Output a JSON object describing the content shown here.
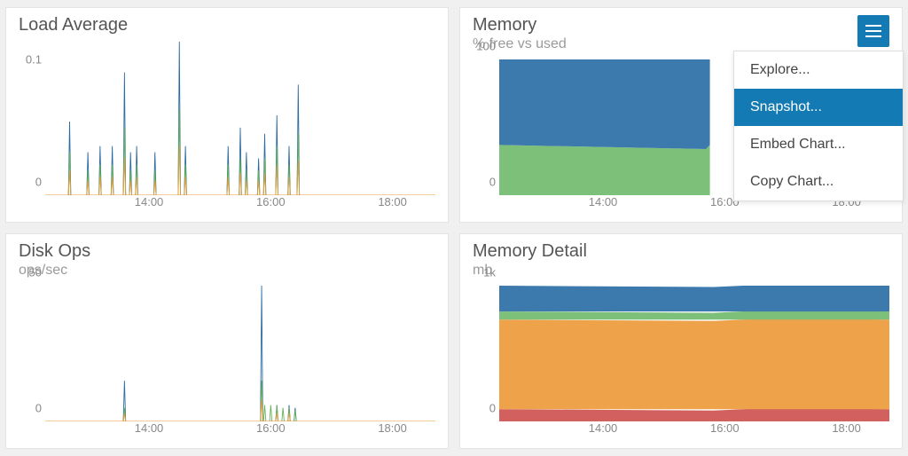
{
  "cards": {
    "loadAvg": {
      "title": "Load Average",
      "subtitle": ""
    },
    "memory": {
      "title": "Memory",
      "subtitle": "% free vs used"
    },
    "diskOps": {
      "title": "Disk Ops",
      "subtitle": "ops/sec"
    },
    "memDetail": {
      "title": "Memory Detail",
      "subtitle": "mb"
    }
  },
  "menu": {
    "items": [
      "Explore...",
      "Snapshot...",
      "Embed Chart...",
      "Copy Chart..."
    ],
    "selectedIndex": 1
  },
  "chart_data": [
    {
      "id": "loadAvg",
      "type": "line",
      "title": "Load Average",
      "xlabel": "",
      "ylabel": "",
      "xlim": [
        12.3,
        18.7
      ],
      "ylim": [
        0,
        0.125
      ],
      "x_ticks": [
        14,
        16,
        18
      ],
      "x_tick_labels": [
        "14:00",
        "16:00",
        "18:00"
      ],
      "y_ticks": [
        0,
        0.1
      ],
      "series": [
        {
          "name": "blue",
          "color": "#2d6ca2",
          "x": [
            12.7,
            13.0,
            13.2,
            13.4,
            13.6,
            13.7,
            13.8,
            14.1,
            14.5,
            14.6,
            15.3,
            15.5,
            15.6,
            15.8,
            15.9,
            16.1,
            16.3,
            16.45
          ],
          "y": [
            0.06,
            0.035,
            0.04,
            0.04,
            0.1,
            0.035,
            0.04,
            0.035,
            0.125,
            0.04,
            0.04,
            0.055,
            0.035,
            0.03,
            0.05,
            0.065,
            0.04,
            0.09
          ]
        },
        {
          "name": "green",
          "color": "#65b257",
          "x": [
            12.7,
            13.0,
            13.2,
            13.4,
            13.6,
            13.7,
            13.8,
            14.1,
            14.5,
            14.6,
            15.3,
            15.5,
            15.6,
            15.8,
            15.9,
            16.1,
            16.3,
            16.45
          ],
          "y": [
            0.035,
            0.02,
            0.025,
            0.025,
            0.055,
            0.02,
            0.025,
            0.02,
            0.07,
            0.025,
            0.025,
            0.03,
            0.02,
            0.02,
            0.03,
            0.04,
            0.025,
            0.05
          ]
        },
        {
          "name": "orange",
          "color": "#e79b3a",
          "x": [
            12.7,
            13.0,
            13.2,
            13.4,
            13.6,
            13.7,
            13.8,
            14.1,
            14.5,
            14.6,
            15.3,
            15.5,
            15.6,
            15.8,
            15.9,
            16.1,
            16.3,
            16.45
          ],
          "y": [
            0.02,
            0.012,
            0.015,
            0.015,
            0.03,
            0.012,
            0.015,
            0.012,
            0.04,
            0.015,
            0.014,
            0.018,
            0.012,
            0.012,
            0.018,
            0.024,
            0.015,
            0.028
          ]
        }
      ]
    },
    {
      "id": "memory",
      "type": "area",
      "title": "Memory – % free vs used",
      "xlabel": "",
      "ylabel": "",
      "xlim": [
        12.3,
        18.7
      ],
      "ylim": [
        0,
        100
      ],
      "x_ticks": [
        14,
        16,
        18
      ],
      "x_tick_labels": [
        "14:00",
        "16:00",
        "18:00"
      ],
      "y_ticks": [
        0,
        100
      ],
      "series": [
        {
          "name": "used",
          "color": "#3c79ad",
          "value": 63
        },
        {
          "name": "free",
          "color": "#7dc07a",
          "value": 37
        }
      ],
      "note": "upper band shrinks slightly near x≈15.8 (free dips to ~34 briefly)"
    },
    {
      "id": "diskOps",
      "type": "line",
      "title": "Disk Ops",
      "xlabel": "",
      "ylabel": "",
      "xlim": [
        12.3,
        18.7
      ],
      "ylim": [
        0,
        50
      ],
      "x_ticks": [
        14,
        16,
        18
      ],
      "x_tick_labels": [
        "14:00",
        "16:00",
        "18:00"
      ],
      "y_ticks": [
        0,
        50
      ],
      "series": [
        {
          "name": "blue",
          "color": "#2d6ca2",
          "x": [
            13.6,
            15.85,
            16.1,
            16.3,
            16.4
          ],
          "y": [
            15,
            50,
            6,
            6,
            5
          ]
        },
        {
          "name": "green",
          "color": "#65b257",
          "x": [
            13.6,
            15.85,
            15.9,
            16.0,
            16.1,
            16.2,
            16.3,
            16.4
          ],
          "y": [
            5,
            15,
            6,
            6,
            6,
            5,
            5,
            4
          ]
        },
        {
          "name": "orange",
          "color": "#e79b3a",
          "x": [
            13.6,
            15.85,
            16.1,
            16.3
          ],
          "y": [
            3,
            8,
            3,
            3
          ]
        }
      ]
    },
    {
      "id": "memDetail",
      "type": "area",
      "title": "Memory Detail (mb)",
      "xlabel": "",
      "ylabel": "",
      "xlim": [
        12.3,
        18.7
      ],
      "ylim": [
        0,
        1000
      ],
      "x_ticks": [
        14,
        16,
        18
      ],
      "x_tick_labels": [
        "14:00",
        "16:00",
        "18:00"
      ],
      "y_ticks": [
        0,
        1000
      ],
      "y_tick_labels": [
        "0",
        "1k"
      ],
      "series": [
        {
          "name": "red",
          "color": "#d2605e",
          "value": 90
        },
        {
          "name": "orange",
          "color": "#eea24a",
          "value": 660
        },
        {
          "name": "green",
          "color": "#7dc07a",
          "value": 60
        },
        {
          "name": "blue",
          "color": "#3c79ad",
          "value": 190
        }
      ]
    }
  ]
}
